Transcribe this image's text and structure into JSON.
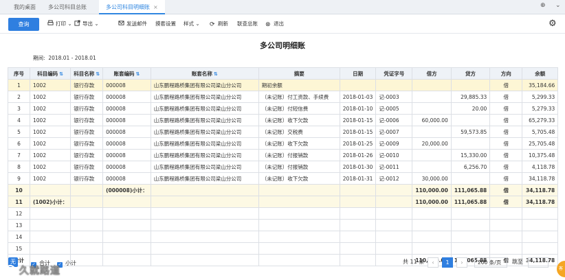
{
  "tabs": [
    {
      "label": "我的桌面"
    },
    {
      "label": "多公司科目总账"
    },
    {
      "label": "多公司科目明细账",
      "close": "×"
    }
  ],
  "window_controls": {
    "pin": "⊕",
    "dropdown": "⌄"
  },
  "toolbar": {
    "query": "查询",
    "print": "打印",
    "export": "导出",
    "send_mail": "发送邮件",
    "template_settings": "摸套设置",
    "style": "样式",
    "refresh": "刷新",
    "joint_ledger": "联查总账",
    "exit": "退出"
  },
  "report": {
    "title": "多公司明细账",
    "period_label": "期间:",
    "period_value": "2018.01 - 2018.01"
  },
  "table": {
    "headers": [
      "序号",
      "科目编码",
      "科目名称",
      "账套编码",
      "账套名称",
      "摘要",
      "日期",
      "凭证字号",
      "借方",
      "贷方",
      "方向",
      "余额"
    ],
    "rows": [
      [
        "1",
        "1002",
        "银行存款",
        "000008",
        "山东鹏程路桥集团有限公司梁山分公司",
        "期初余额",
        "",
        "",
        "",
        "",
        "借",
        "35,184.66"
      ],
      [
        "2",
        "1002",
        "银行存款",
        "000008",
        "山东鹏程路桥集团有限公司梁山分公司",
        "（未记账）付工资款、手续费",
        "2018-01-03",
        "记-0003",
        "",
        "29,885.33",
        "借",
        "5,299.33"
      ],
      [
        "3",
        "1002",
        "银行存款",
        "000008",
        "山东鹏程路桥集团有限公司梁山分公司",
        "（未记账）付短信费",
        "2018-01-10",
        "记-0005",
        "",
        "20.00",
        "借",
        "5,279.33"
      ],
      [
        "4",
        "1002",
        "银行存款",
        "000008",
        "山东鹏程路桥集团有限公司梁山分公司",
        "（未记账）收下欠款",
        "2018-01-15",
        "记-0006",
        "60,000.00",
        "",
        "借",
        "65,279.33"
      ],
      [
        "5",
        "1002",
        "银行存款",
        "000008",
        "山东鹏程路桥集团有限公司梁山分公司",
        "（未记账）交税费",
        "2018-01-15",
        "记-0007",
        "",
        "59,573.85",
        "借",
        "5,705.48"
      ],
      [
        "6",
        "1002",
        "银行存款",
        "000008",
        "山东鹏程路桥集团有限公司梁山分公司",
        "（未记账）收下欠款",
        "2018-01-25",
        "记-0009",
        "20,000.00",
        "",
        "借",
        "25,705.48"
      ],
      [
        "7",
        "1002",
        "银行存款",
        "000008",
        "山东鹏程路桥集团有限公司梁山分公司",
        "（未记账）付报销款",
        "2018-01-26",
        "记-0010",
        "",
        "15,330.00",
        "借",
        "10,375.48"
      ],
      [
        "8",
        "1002",
        "银行存款",
        "000008",
        "山东鹏程路桥集团有限公司梁山分公司",
        "（未记账）付报销款",
        "2018-01-30",
        "记-0011",
        "",
        "6,256.70",
        "借",
        "4,118.78"
      ],
      [
        "9",
        "1002",
        "银行存款",
        "000008",
        "山东鹏程路桥集团有限公司梁山分公司",
        "（未记账）收下欠款",
        "2018-01-31",
        "记-0012",
        "30,000.00",
        "",
        "借",
        "34,118.78"
      ]
    ],
    "subtotal_account": {
      "no": "10",
      "label": "(000008)小计：",
      "debit": "110,000.00",
      "credit": "111,065.88",
      "dir": "借",
      "balance": "34,118.78"
    },
    "subtotal_subject": {
      "no": "11",
      "label": "(1002)小计：",
      "debit": "110,000.00",
      "credit": "111,065.88",
      "dir": "借",
      "balance": "34,118.78"
    },
    "empty_rows": [
      "12",
      "13",
      "14",
      "15"
    ],
    "total": {
      "label": "合计",
      "debit": "110,000.00",
      "credit": "111,065.88",
      "dir": "借",
      "balance": "34,118.78"
    }
  },
  "footer": {
    "blue_btn": "无",
    "check_total": "合计",
    "check_subtotal": "小计",
    "record_count": "共 11 条",
    "prev": "‹",
    "page": "1",
    "next": "›",
    "page_size": "200 条/页",
    "jump_label": "跳至",
    "jump_suffix": "页"
  },
  "watermark": "久就路道",
  "orange_widget": "客"
}
